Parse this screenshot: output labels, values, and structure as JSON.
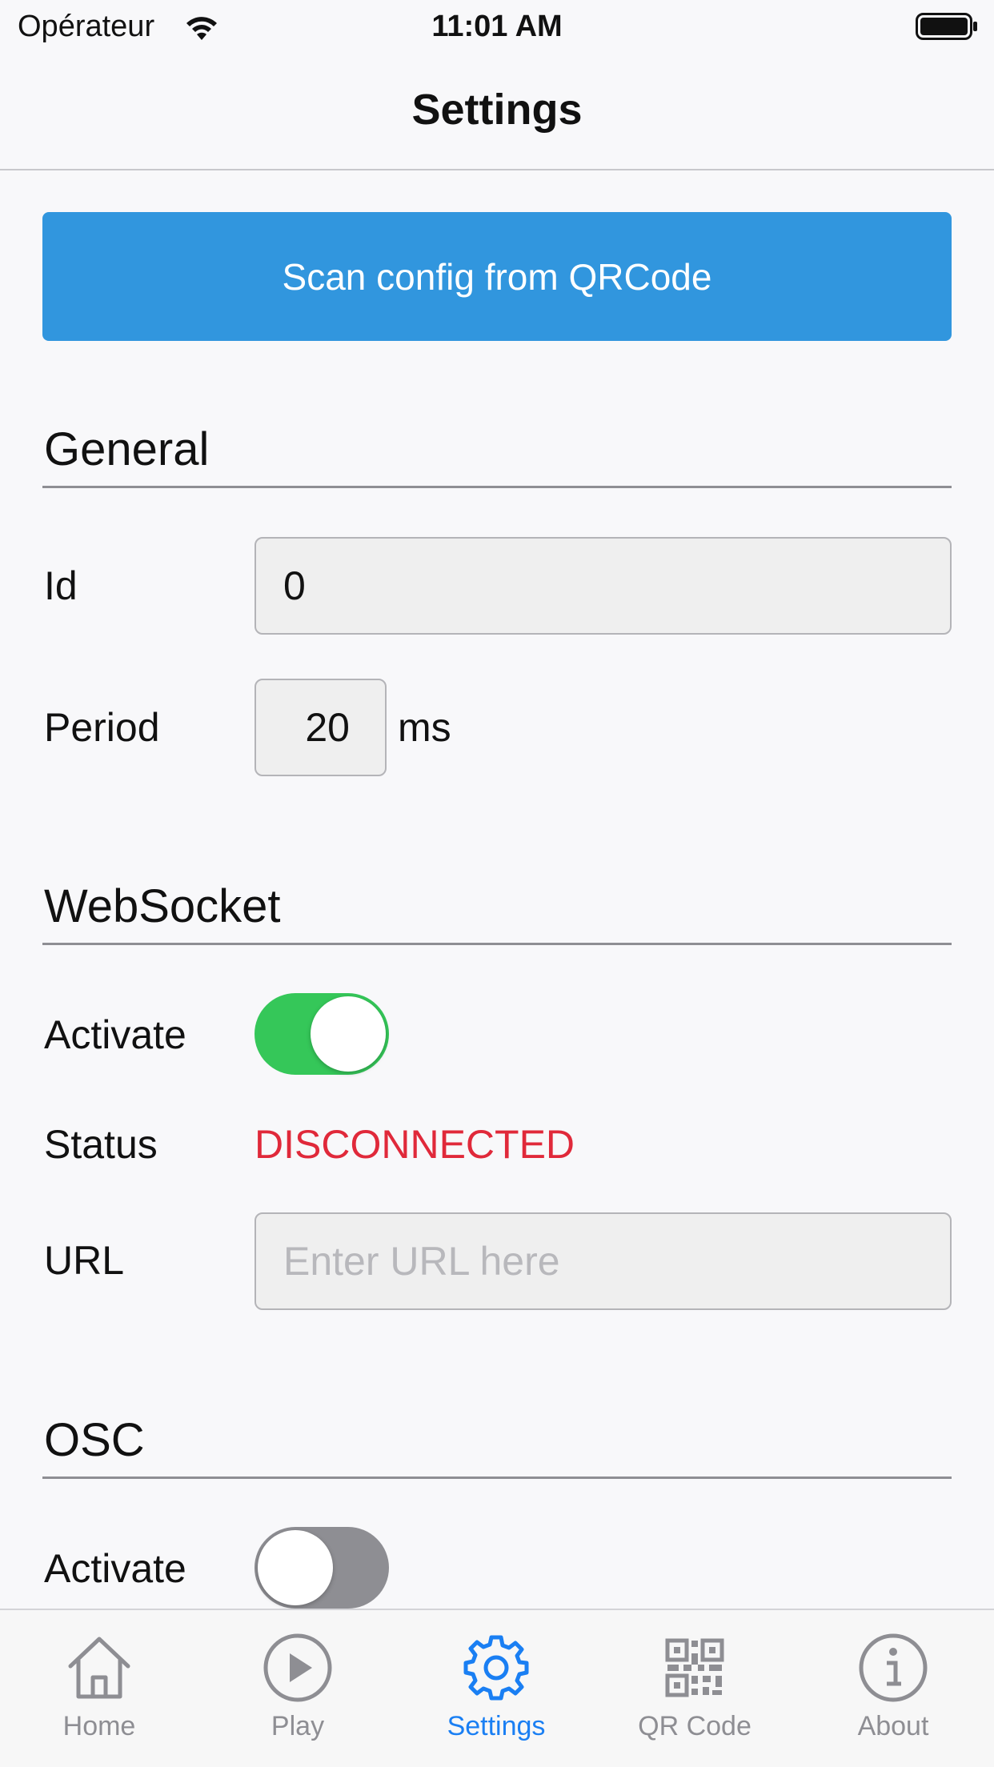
{
  "status_bar": {
    "carrier": "Opérateur",
    "time": "11:01 AM"
  },
  "nav": {
    "title": "Settings"
  },
  "scan_button": {
    "label": "Scan config from QRCode"
  },
  "general": {
    "title": "General",
    "id_label": "Id",
    "id_value": "0",
    "period_label": "Period",
    "period_value": "20",
    "period_unit": "ms"
  },
  "websocket": {
    "title": "WebSocket",
    "activate_label": "Activate",
    "activate_on": true,
    "status_label": "Status",
    "status_value": "DISCONNECTED",
    "url_label": "URL",
    "url_placeholder": "Enter URL here",
    "url_value": ""
  },
  "osc": {
    "title": "OSC",
    "activate_label": "Activate",
    "activate_on": false
  },
  "tabs": [
    {
      "label": "Home",
      "icon": "home-icon",
      "active": false
    },
    {
      "label": "Play",
      "icon": "play-icon",
      "active": false
    },
    {
      "label": "Settings",
      "icon": "gear-icon",
      "active": true
    },
    {
      "label": "QR Code",
      "icon": "qr-code-icon",
      "active": false
    },
    {
      "label": "About",
      "icon": "info-icon",
      "active": false
    }
  ],
  "colors": {
    "accent": "#3196de",
    "tab_active": "#1a7ff3",
    "tab_inactive": "#8e8e93",
    "toggle_on": "#35c759",
    "status_error": "#e0293a"
  }
}
